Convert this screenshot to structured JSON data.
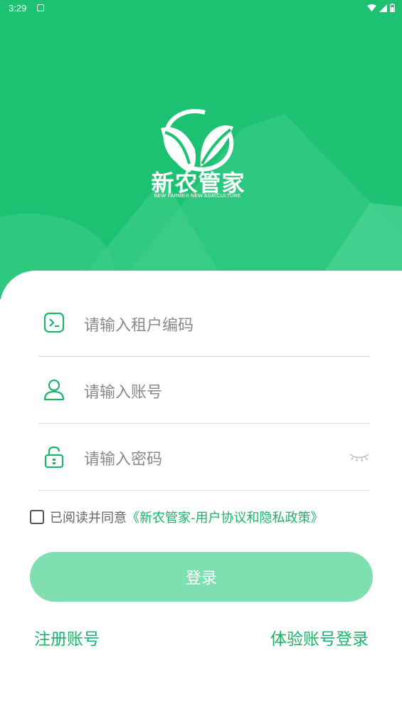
{
  "status_bar": {
    "time": "3:29"
  },
  "brand": {
    "name": "新农管家",
    "tagline": "NEW FARMER NEW AGRICULTURE"
  },
  "form": {
    "tenant_placeholder": "请输入租户编码",
    "account_placeholder": "请输入账号",
    "password_placeholder": "请输入密码"
  },
  "agreement": {
    "prefix": "已阅读并同意",
    "link": "《新农管家-用户协议和隐私政策》",
    "checked": false
  },
  "login_label": "登录",
  "register_label": "注册账号",
  "trial_login_label": "体验账号登录",
  "colors": {
    "brand": "#1cc272",
    "button_disabled": "#7fdfb0",
    "link": "#1cb36b"
  }
}
